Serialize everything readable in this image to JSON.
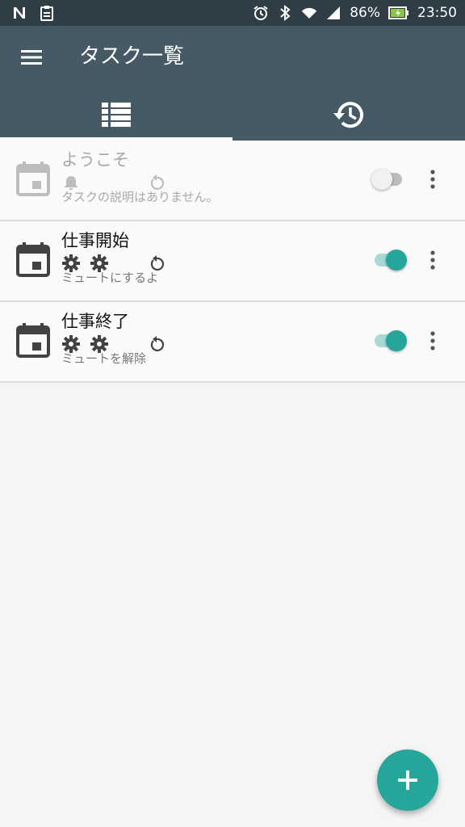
{
  "status_bar": {
    "battery": "86%",
    "time": "23:50",
    "icons": [
      "n-notification-icon",
      "clipboard-notification-icon",
      "alarm-icon",
      "bluetooth-icon",
      "wifi-icon",
      "signal-icon",
      "battery-charging-icon"
    ]
  },
  "app_bar": {
    "title": "タスク一覧",
    "menu_icon": "menu-icon",
    "tabs": [
      {
        "icon": "list-icon",
        "active": true
      },
      {
        "icon": "history-icon",
        "active": false
      }
    ]
  },
  "tasks": [
    {
      "title": "ようこそ",
      "subtitle": "タスクの説明はありません。",
      "enabled": false,
      "icons": [
        "bell-icon",
        "repeat-icon"
      ]
    },
    {
      "title": "仕事開始",
      "subtitle": "ミュートにするよ",
      "enabled": true,
      "icons": [
        "gear-icon",
        "gear-icon",
        "repeat-icon"
      ]
    },
    {
      "title": "仕事終了",
      "subtitle": "ミュートを解除",
      "enabled": true,
      "icons": [
        "gear-icon",
        "gear-icon",
        "repeat-icon"
      ]
    }
  ],
  "fab": {
    "icon": "add-icon"
  },
  "colors": {
    "status_bar": "#2f3e46",
    "app_bar": "#455a64",
    "accent": "#26a69a",
    "background": "#fafafa"
  }
}
